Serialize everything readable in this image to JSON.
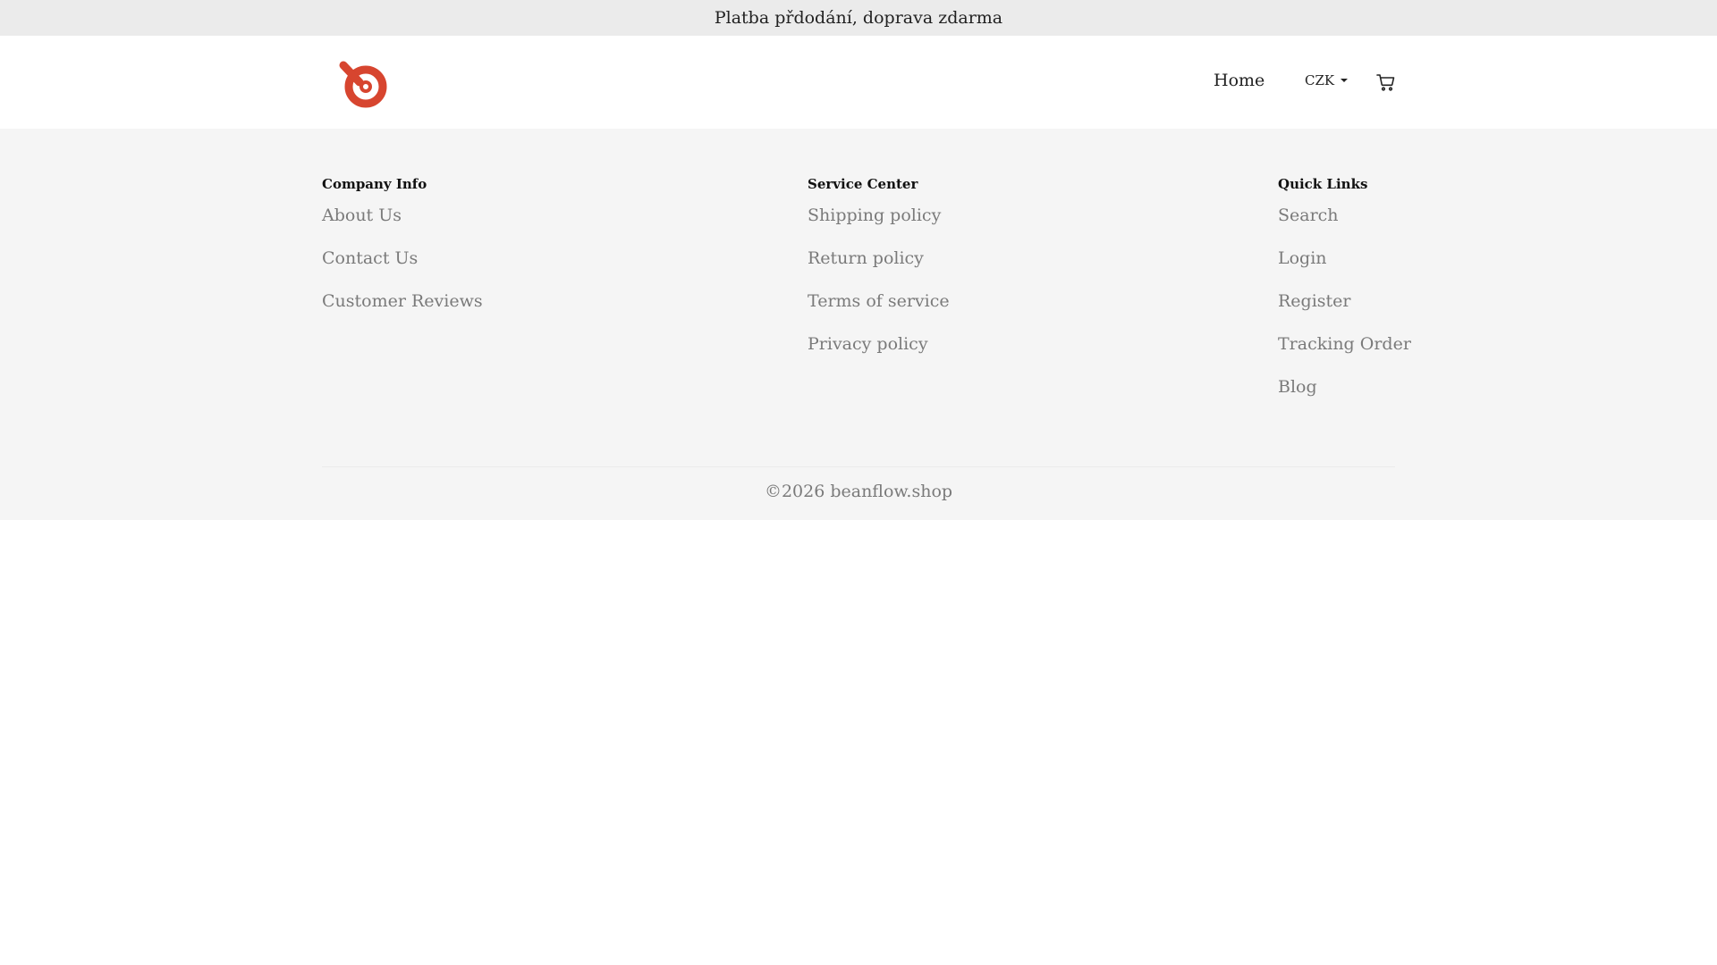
{
  "announcement": "Platba přdodání, doprava zdarma",
  "header": {
    "nav_home": "Home",
    "currency": "CZK",
    "logo_icon": "brand-logo-icon",
    "cart_icon": "cart-icon",
    "accent_color": "#d7452f"
  },
  "footer": {
    "columns": [
      {
        "title": "Company Info",
        "links": [
          "About Us",
          "Contact Us",
          "Customer Reviews"
        ]
      },
      {
        "title": "Service Center",
        "links": [
          "Shipping policy",
          "Return policy",
          "Terms of service",
          "Privacy policy"
        ]
      },
      {
        "title": "Quick Links",
        "links": [
          "Search",
          "Login",
          "Register",
          "Tracking Order",
          "Blog"
        ]
      }
    ],
    "copyright": "©2026 beanflow.shop"
  }
}
